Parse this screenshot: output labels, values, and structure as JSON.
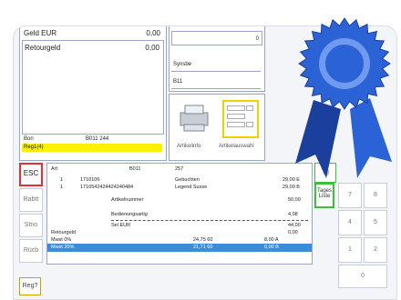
{
  "top_panel": {
    "currency_label": "Geld EUR",
    "currency_value": "0,00",
    "retour_label": "Retourgeld",
    "retour_value": "0,00",
    "bon_label": "Bon",
    "bon_value": "B011 244",
    "register_label": "Reg1(4)"
  },
  "mid_panel": {
    "field_value": "0",
    "system_label": "Synsbe",
    "code_label": "B11"
  },
  "article_panel": {
    "article_info_label": "Artikelinfo",
    "article_selection_label": "Artikelauswahl"
  },
  "left_buttons": {
    "esc": "ESC",
    "rabatt": "Rabtt",
    "storno": "Stno",
    "rueck": "Rücb",
    "reg": "Reg?"
  },
  "receipt": {
    "header_col1": "Art",
    "header_col2": "B011",
    "header_col3": "257",
    "lines": [
      {
        "qty": "1",
        "code": "1710106",
        "name": "Gebuchten",
        "amount": "29,00 E"
      },
      {
        "qty": "1",
        "code": "1710542424424240484",
        "name": "Legend Susse",
        "amount": "29,00 B"
      },
      {
        "qty": "",
        "code": "",
        "name": "Artikelnummer",
        "amount": "50,00"
      },
      {
        "qty": "",
        "code": "",
        "name": "Bedienungsartig",
        "amount": "4,08"
      },
      {
        "qty": "",
        "code": "Sel EUR",
        "name": "",
        "amount": "44,00"
      },
      {
        "qty": "",
        "code": "Retourgeld",
        "name": "",
        "amount": "0,00"
      },
      {
        "qty": "",
        "code": "Mwst 0%",
        "name": "24,75 60",
        "amount": "8,00 A"
      }
    ],
    "selected": {
      "code": "Mwst 20%",
      "name": "21,71 60",
      "amount": "0,00 B"
    }
  },
  "right_buttons": {
    "top": "Tg",
    "tagesliste": "Tages Liste",
    "k7": "7",
    "k8": "8",
    "k4": "4",
    "k5": "5",
    "k1": "1",
    "k2": "2",
    "k0": "0"
  },
  "ribbon": {
    "color_main": "#2b62d6",
    "color_dark": "#1a3f9c",
    "color_light": "#6f9af0"
  }
}
